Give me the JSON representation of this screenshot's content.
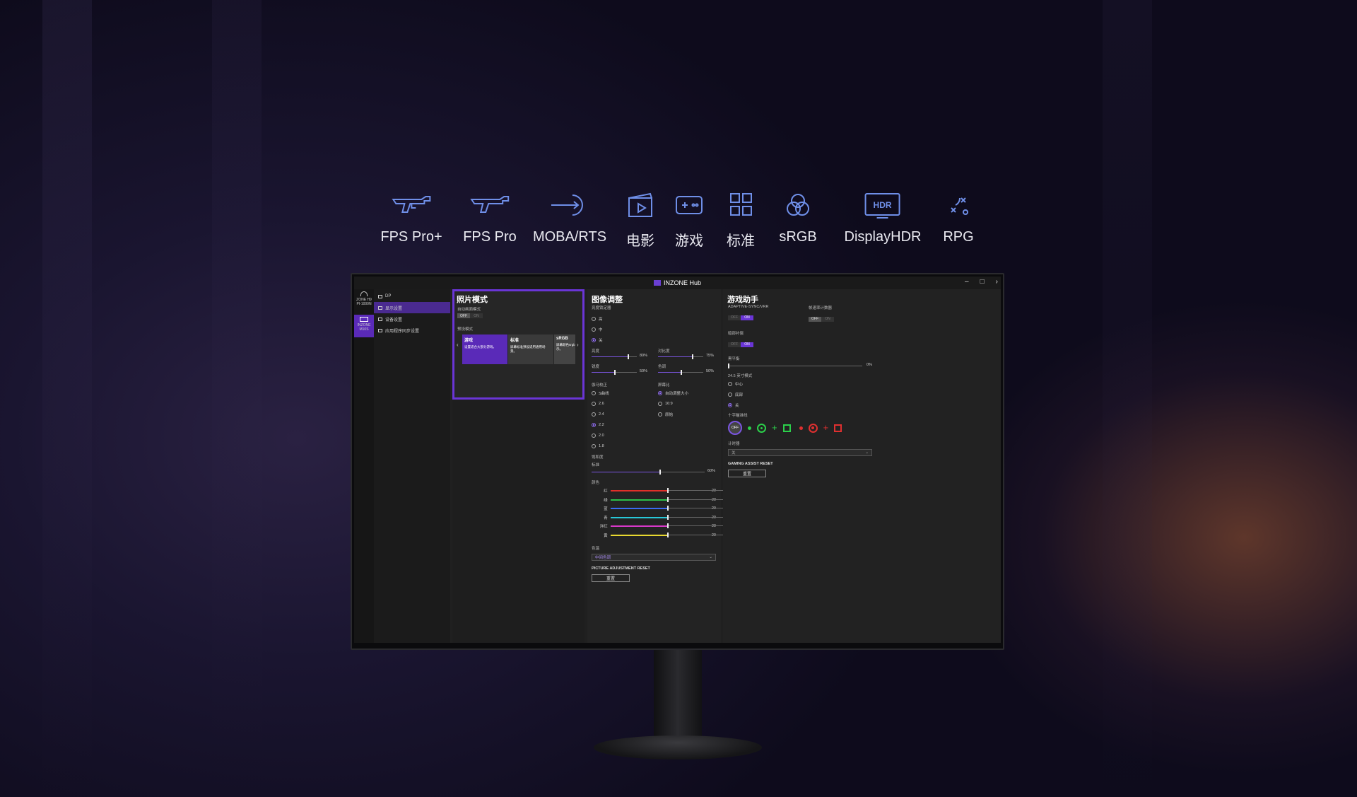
{
  "modes": [
    {
      "label": "FPS Pro+",
      "icon": "rifle-icon"
    },
    {
      "label": "FPS Pro",
      "icon": "rifle-icon"
    },
    {
      "label": "MOBA/RTS",
      "icon": "target-arrow-icon"
    },
    {
      "label": "电影",
      "icon": "clapperboard-icon"
    },
    {
      "label": "游戏",
      "icon": "gamepad-icon"
    },
    {
      "label": "标准",
      "icon": "grid-icon"
    },
    {
      "label": "sRGB",
      "icon": "rgb-circles-icon"
    },
    {
      "label": "DisplayHDR",
      "icon": "hdr-icon"
    },
    {
      "label": "RPG",
      "icon": "strategy-icon"
    }
  ],
  "window": {
    "title": "INZONE Hub",
    "minimize": "–",
    "maximize": "□",
    "close": "›"
  },
  "devices": [
    {
      "label": "ZONE H9 PI-1000N",
      "icon": "headset-icon"
    },
    {
      "label": "INZONE M10S",
      "icon": "monitor-icon"
    }
  ],
  "nav": {
    "items": [
      {
        "label": "DP",
        "icon": "input-icon"
      },
      {
        "label": "显示设置",
        "icon": "display-icon"
      },
      {
        "label": "设备设置",
        "icon": "device-icon"
      },
      {
        "label": "应用程序同步设置",
        "icon": "sync-icon"
      }
    ]
  },
  "photo_mode": {
    "title": "照片模式",
    "auto_label": "自动画面模式",
    "toggle_off": "OFF",
    "toggle_on": "ON",
    "preset_label": "预设模式",
    "cards": [
      {
        "title": "游戏",
        "desc": "设置适合大部分游戏。"
      },
      {
        "title": "标准",
        "desc": "屏幕标准预设适用通用场景。"
      },
      {
        "title": "sRGB",
        "desc": "屏幕颜色srgb色彩空间显示。"
      }
    ]
  },
  "picture": {
    "title": "图像调整",
    "brightness_group": "亮度锁定器",
    "brightness_opts": [
      "高",
      "中",
      "关"
    ],
    "brightness": {
      "label": "亮度",
      "value": 80,
      "text": "80%"
    },
    "contrast": {
      "label": "对比度",
      "value": 75,
      "text": "75%"
    },
    "sharpness": {
      "label": "锐度",
      "value": 50,
      "text": "50%"
    },
    "hue": {
      "label": "色调",
      "value": 50,
      "text": "50%"
    },
    "gamma_label": "伽马校正",
    "gamma_opts": [
      "S曲线",
      "2.6",
      "2.4",
      "2.2",
      "2.0",
      "1.8"
    ],
    "aspect_label": "屏幕比",
    "aspect_opts": [
      "自动调整大小",
      "16:9",
      "原始"
    ],
    "saturation_label": "饱和度",
    "saturation_sub": "标准",
    "saturation": {
      "value": 60,
      "text": "60%"
    },
    "color_label": "颜色",
    "colors": [
      {
        "name": "红",
        "value": 20,
        "color": "#e0302a"
      },
      {
        "name": "绿",
        "value": 20,
        "color": "#2bc04a"
      },
      {
        "name": "蓝",
        "value": 20,
        "color": "#3a6bf0"
      },
      {
        "name": "青",
        "value": 20,
        "color": "#28c8d8"
      },
      {
        "name": "洋红",
        "value": 20,
        "color": "#d838c8"
      },
      {
        "name": "黄",
        "value": 20,
        "color": "#e8d830"
      }
    ],
    "temp_label": "色温",
    "temp_value": "中间色调",
    "reset_title": "PICTURE ADJUSTMENT RESET",
    "reset_btn": "重置"
  },
  "game": {
    "title": "游戏助手",
    "vrr_label": "ADAPTIVE-SYNC/VRR",
    "fps_label": "帧速率计数器",
    "bl_label": "暗部补偿",
    "black_eq_label": "黑平衡",
    "black_eq": {
      "value": 0,
      "text": "0%"
    },
    "window_label": "24.5 英寸模式",
    "window_opts": [
      "中心",
      "底部",
      "关"
    ],
    "crosshair_label": "十字瞄准线",
    "crosshair_off": "OFF",
    "timer_label": "计时器",
    "timer_value": "关",
    "reset_title": "GAMING ASSIST RESET",
    "reset_btn": "重置"
  },
  "accent": "#6a35d6"
}
